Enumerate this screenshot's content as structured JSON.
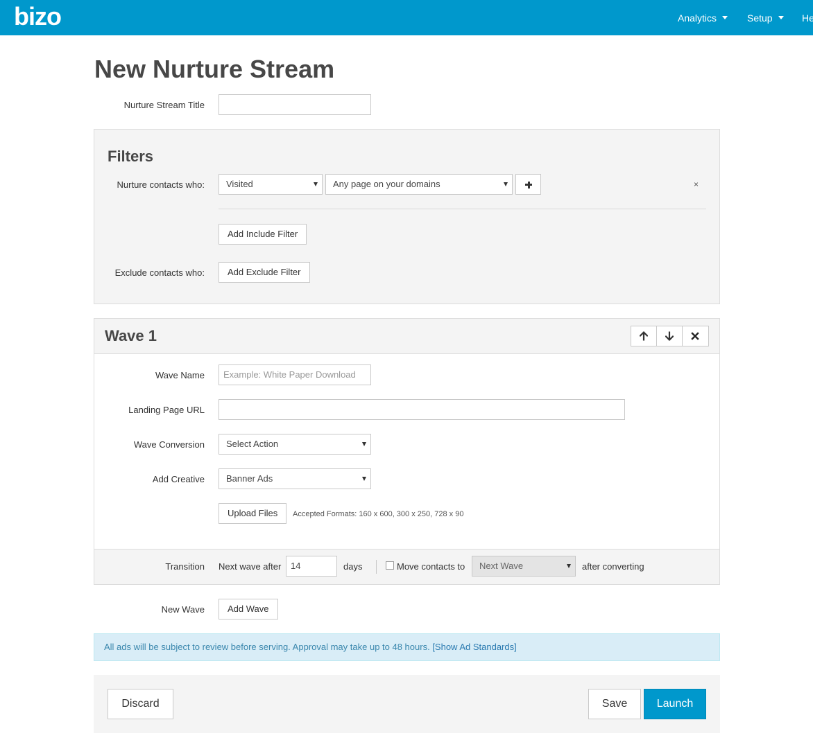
{
  "brand": {
    "logo_text": "bizo"
  },
  "nav": [
    {
      "label": "Analytics"
    },
    {
      "label": "Setup"
    },
    {
      "label": "He"
    }
  ],
  "page": {
    "title": "New Nurture Stream"
  },
  "stream_title": {
    "label": "Nurture Stream Title",
    "value": ""
  },
  "filters": {
    "title": "Filters",
    "nurture_label": "Nurture contacts who:",
    "action_select": "Visited",
    "target_select": "Any page on your domains",
    "remove_glyph": "×",
    "add_include": "Add Include Filter",
    "exclude_label": "Exclude contacts who:",
    "add_exclude": "Add Exclude Filter"
  },
  "wave": {
    "title": "Wave 1",
    "name_label": "Wave Name",
    "name_placeholder": "Example: White Paper Download",
    "url_label": "Landing Page URL",
    "url_value": "",
    "conversion_label": "Wave Conversion",
    "conversion_select": "Select Action",
    "creative_label": "Add Creative",
    "creative_select": "Banner Ads",
    "upload_button": "Upload Files",
    "accepted_formats": "Accepted Formats: 160 x 600, 300 x 250, 728 x 90"
  },
  "transition": {
    "label": "Transition",
    "next_wave_after": "Next wave after",
    "days_value": "14",
    "days_label": "days",
    "move_contacts_label": "Move contacts to",
    "move_contacts_checked": false,
    "move_target": "Next Wave",
    "after_converting": "after converting"
  },
  "new_wave": {
    "label": "New Wave",
    "button": "Add Wave"
  },
  "notice": {
    "text": "All ads will be subject to review before serving. Approval may take up to 48 hours. ",
    "link": "[Show Ad Standards]"
  },
  "footer": {
    "discard": "Discard",
    "save": "Save",
    "launch": "Launch"
  },
  "colors": {
    "brand": "#0098cc",
    "panel": "#f4f4f4",
    "notice_bg": "#d9edf7",
    "notice_text": "#3a87ad"
  }
}
